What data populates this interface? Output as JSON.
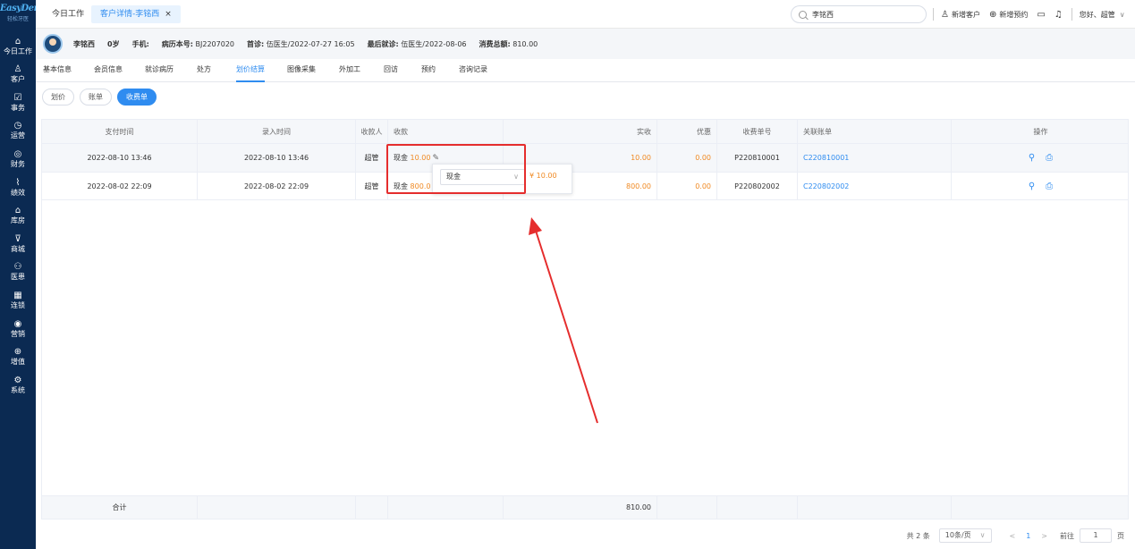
{
  "sidebar": {
    "logo": "EasyDent",
    "logo_sub": "轻松牙医",
    "items": [
      {
        "label": "今日工作",
        "icon": "home-icon",
        "glyph": "⌂"
      },
      {
        "label": "客户",
        "icon": "user-icon",
        "glyph": "♙"
      },
      {
        "label": "事务",
        "icon": "task-icon",
        "glyph": "☑"
      },
      {
        "label": "运营",
        "icon": "clock-icon",
        "glyph": "◷"
      },
      {
        "label": "财务",
        "icon": "wallet-icon",
        "glyph": "◎"
      },
      {
        "label": "绩效",
        "icon": "chart-icon",
        "glyph": "⌇"
      },
      {
        "label": "库房",
        "icon": "warehouse-icon",
        "glyph": "⌂"
      },
      {
        "label": "商城",
        "icon": "cart-icon",
        "glyph": "⊽"
      },
      {
        "label": "医患",
        "icon": "doctor-patient-icon",
        "glyph": "⚇"
      },
      {
        "label": "连锁",
        "icon": "chain-icon",
        "glyph": "▦"
      },
      {
        "label": "营销",
        "icon": "marketing-icon",
        "glyph": "◉"
      },
      {
        "label": "增值",
        "icon": "value-added-icon",
        "glyph": "⊕"
      },
      {
        "label": "系统",
        "icon": "settings-icon",
        "glyph": "⚙"
      }
    ]
  },
  "topbar": {
    "tab_home": "今日工作",
    "tab_active": "客户详情-李铭西",
    "tab_close": "×",
    "search_value": "李铭西",
    "add_customer": "新增客户",
    "add_appointment": "新增预约",
    "greeting": "您好、超管",
    "greeting_chevron": "∨"
  },
  "patient": {
    "name": "李铭西",
    "age": "0岁",
    "phone_label": "手机:",
    "record_label": "病历本号:",
    "record_no": "BJ2207020",
    "first_label": "首诊:",
    "first_visit": "伍医生/2022-07-27 16:05",
    "last_label": "最后就诊:",
    "last_visit": "伍医生/2022-08-06",
    "total_label": "消费总额:",
    "total": "810.00"
  },
  "subtabs": [
    "基本信息",
    "会员信息",
    "就诊病历",
    "处方",
    "划价结算",
    "图像采集",
    "外加工",
    "回访",
    "预约",
    "咨询记录"
  ],
  "pills": [
    "划价",
    "账单",
    "收费单"
  ],
  "table": {
    "headers": [
      "支付时间",
      "录入时间",
      "收款人",
      "收款",
      "",
      "实收",
      "优惠",
      "收费单号",
      "关联账单",
      "操作"
    ],
    "rows": [
      {
        "pay_time": "2022-08-10 13:46",
        "entry_time": "2022-08-10 13:46",
        "payee": "超管",
        "method": "现金",
        "amount": "10.00",
        "actual": "10.00",
        "discount": "0.00",
        "charge_no": "P220810001",
        "bill_no": "C220810001"
      },
      {
        "pay_time": "2022-08-02 22:09",
        "entry_time": "2022-08-02 22:09",
        "payee": "超管",
        "method": "现金",
        "amount": "800.0",
        "actual": "800.00",
        "discount": "0.00",
        "charge_no": "P220802002",
        "bill_no": "C220802002"
      }
    ],
    "footer_label": "合计",
    "footer_total": "810.00"
  },
  "popover": {
    "select_value": "现金",
    "amount": "¥ 10.00"
  },
  "pagination": {
    "total_text": "共 2 条",
    "page_size": "10条/页",
    "prev": "<",
    "current": "1",
    "next": ">",
    "goto_label": "前往",
    "goto_value": "1",
    "page_unit": "页"
  },
  "colors": {
    "sidebar_bg": "#0b2a52",
    "accent": "#2f8cf0",
    "amount": "#f08a24",
    "annotation": "#e52d2d"
  }
}
